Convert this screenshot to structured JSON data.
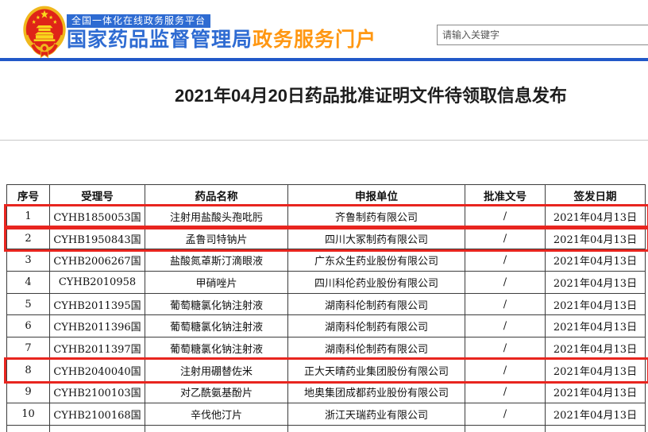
{
  "header": {
    "platform_badge": "全国一体化在线政务服务平台",
    "site_name": "国家药品监督管理局",
    "site_suffix": "政务服务门户",
    "search": {
      "placeholder": "请输入关键字",
      "value": ""
    }
  },
  "icons": {
    "logo": "china-national-emblem"
  },
  "page": {
    "title": "2021年04月20日药品批准证明文件待领取信息发布"
  },
  "table": {
    "headers": [
      "序号",
      "受理号",
      "药品名称",
      "申报单位",
      "批准文号",
      "签发日期"
    ],
    "rows": [
      {
        "no": "1",
        "acceptance_no": "CYHB1850053国",
        "drug_name": "注射用盐酸头孢吡肟",
        "applicant": "齐鲁制药有限公司",
        "approval_no": "/",
        "issue_date": "2021年04月13日",
        "highlighted": true
      },
      {
        "no": "2",
        "acceptance_no": "CYHB1950843国",
        "drug_name": "孟鲁司特钠片",
        "applicant": "四川大冢制药有限公司",
        "approval_no": "/",
        "issue_date": "2021年04月13日",
        "highlighted": true
      },
      {
        "no": "3",
        "acceptance_no": "CYHB2006267国",
        "drug_name": "盐酸氮䓬斯汀滴眼液",
        "applicant": "广东众生药业股份有限公司",
        "approval_no": "/",
        "issue_date": "2021年04月13日",
        "highlighted": false
      },
      {
        "no": "4",
        "acceptance_no": "CYHB2010958",
        "drug_name": "甲硝唑片",
        "applicant": "四川科伦药业股份有限公司",
        "approval_no": "/",
        "issue_date": "2021年04月13日",
        "highlighted": false
      },
      {
        "no": "5",
        "acceptance_no": "CYHB2011395国",
        "drug_name": "葡萄糖氯化钠注射液",
        "applicant": "湖南科伦制药有限公司",
        "approval_no": "/",
        "issue_date": "2021年04月13日",
        "highlighted": false
      },
      {
        "no": "6",
        "acceptance_no": "CYHB2011396国",
        "drug_name": "葡萄糖氯化钠注射液",
        "applicant": "湖南科伦制药有限公司",
        "approval_no": "/",
        "issue_date": "2021年04月13日",
        "highlighted": false
      },
      {
        "no": "7",
        "acceptance_no": "CYHB2011397国",
        "drug_name": "葡萄糖氯化钠注射液",
        "applicant": "湖南科伦制药有限公司",
        "approval_no": "/",
        "issue_date": "2021年04月13日",
        "highlighted": false
      },
      {
        "no": "8",
        "acceptance_no": "CYHB2040040国",
        "drug_name": "注射用硼替佐米",
        "applicant": "正大天晴药业集团股份有限公司",
        "approval_no": "/",
        "issue_date": "2021年04月13日",
        "highlighted": true
      },
      {
        "no": "9",
        "acceptance_no": "CYHB2100103国",
        "drug_name": "对乙酰氨基酚片",
        "applicant": "地奥集团成都药业股份有限公司",
        "approval_no": "/",
        "issue_date": "2021年04月13日",
        "highlighted": false
      },
      {
        "no": "10",
        "acceptance_no": "CYHB2100168国",
        "drug_name": "辛伐他汀片",
        "applicant": "浙江天瑞药业有限公司",
        "approval_no": "/",
        "issue_date": "2021年04月13日",
        "highlighted": false
      }
    ]
  },
  "colors": {
    "brand_blue": "#2e6bd2",
    "accent_orange": "#ff9712",
    "divider_blue": "#2158c8",
    "highlight_red": "#e8251f",
    "table_border": "#3c3c3c"
  }
}
